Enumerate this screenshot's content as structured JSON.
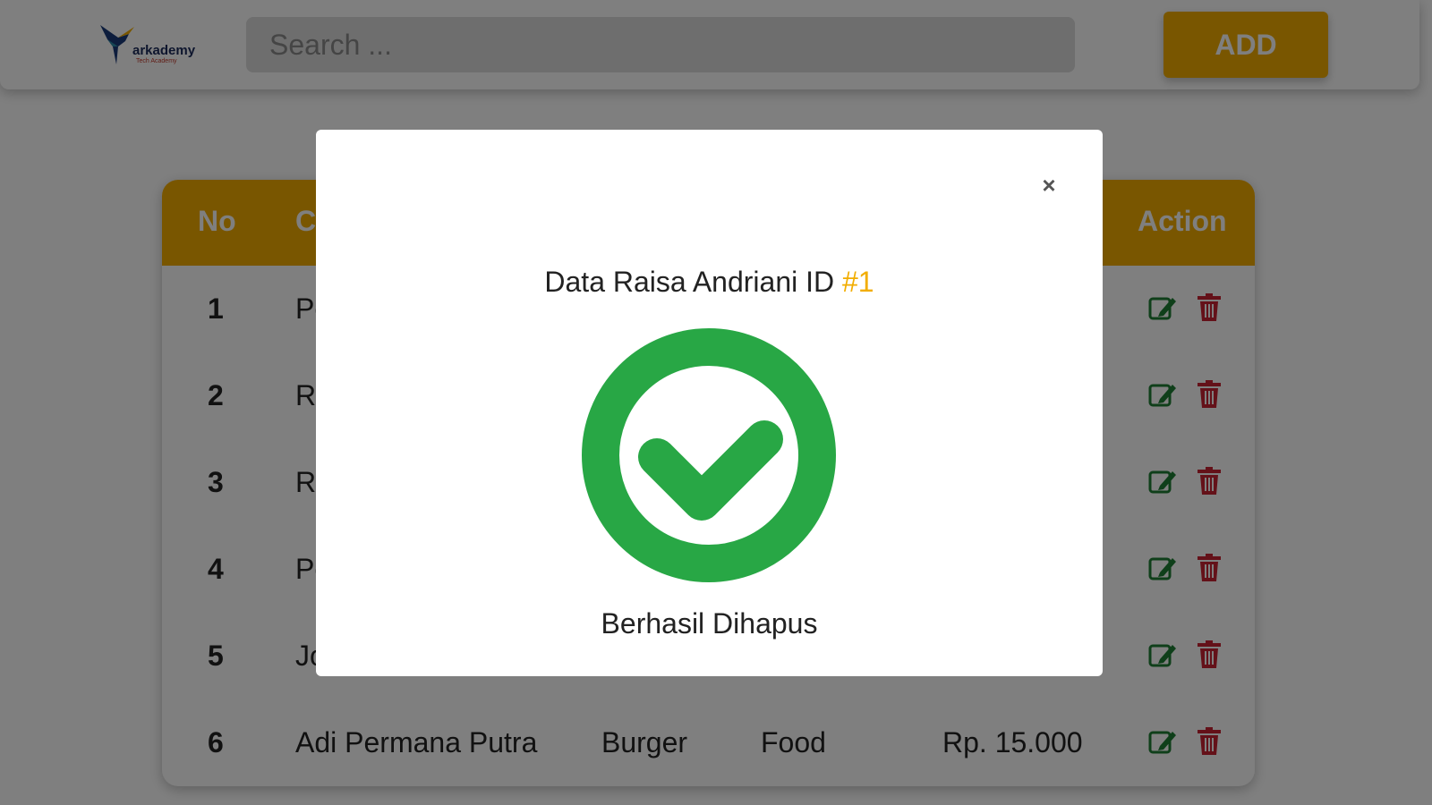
{
  "navbar": {
    "logo_text": "arkademy",
    "logo_sub": "Tech Academy",
    "search_placeholder": "Search ...",
    "add_label": "ADD"
  },
  "table": {
    "headers": {
      "no": "No",
      "c": "C",
      "action": "Action"
    },
    "rows": [
      {
        "no": "1",
        "name": "Pe"
      },
      {
        "no": "2",
        "name": "Ra"
      },
      {
        "no": "3",
        "name": "Ra"
      },
      {
        "no": "4",
        "name": "Pe"
      },
      {
        "no": "5",
        "name": "Jo"
      },
      {
        "no": "6",
        "name": "Adi Permana Putra",
        "product": "Burger",
        "category": "Food",
        "price": "Rp. 15.000"
      }
    ]
  },
  "modal": {
    "close_label": "×",
    "title": "Data Raisa Andriani ID ",
    "title_id": "#1",
    "message": "Berhasil Dihapus",
    "icon": "check-circle-icon"
  },
  "colors": {
    "accent": "#f2ad00",
    "success": "#28a745",
    "edit": "#1e7e34",
    "delete": "#c82333"
  }
}
